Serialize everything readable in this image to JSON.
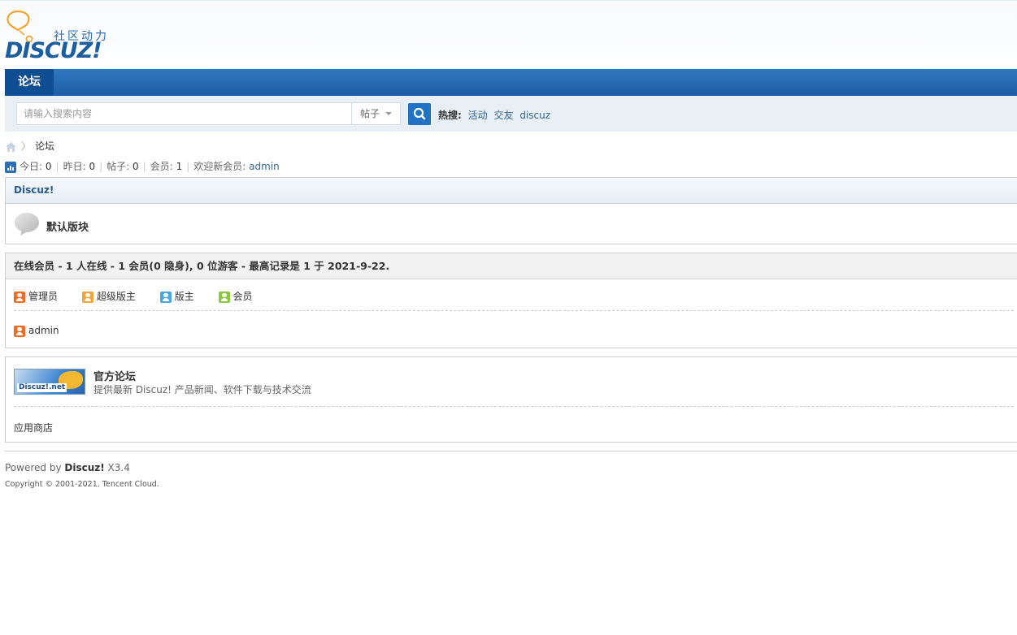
{
  "header": {
    "logo_slogan": "社区动力",
    "logo_word": "DISCUZ!"
  },
  "nav": {
    "tab": "论坛"
  },
  "search": {
    "placeholder": "请输入搜索内容",
    "type": "帖子",
    "hot_label": "热搜:",
    "hot_terms": [
      "活动",
      "交友",
      "discuz"
    ]
  },
  "breadcrumb": {
    "current": "论坛"
  },
  "stats": {
    "today_label": "今日:",
    "today": "0",
    "yesterday_label": "昨日:",
    "yesterday": "0",
    "posts_label": "帖子:",
    "posts": "0",
    "members_label": "会员:",
    "members": "1",
    "newest_label": "欢迎新会员:",
    "newest": "admin"
  },
  "forum": {
    "category": "Discuz!",
    "board": "默认版块"
  },
  "online": {
    "heading": "在线会员 - 1 人在线 - 1 会员(0 隐身), 0 位游客 - 最高记录是 1 于 2021-9-22.",
    "legend": [
      {
        "label": "管理员",
        "color": "#f26c24"
      },
      {
        "label": "超级版主",
        "color": "#f4a43a"
      },
      {
        "label": "版主",
        "color": "#4aa8de"
      },
      {
        "label": "会员",
        "color": "#8cc63e"
      }
    ],
    "users": [
      "admin"
    ]
  },
  "links": {
    "image_badge": "Discuz!.net",
    "title": "官方论坛",
    "desc": "提供最新 Discuz! 产品新闻、软件下载与技术交流",
    "text_link": "应用商店"
  },
  "footer": {
    "powered_prefix": "Powered by ",
    "powered_brand": "Discuz!",
    "version": " X3.4",
    "copyright": "Copyright © 2001-2021, Tencent Cloud."
  }
}
